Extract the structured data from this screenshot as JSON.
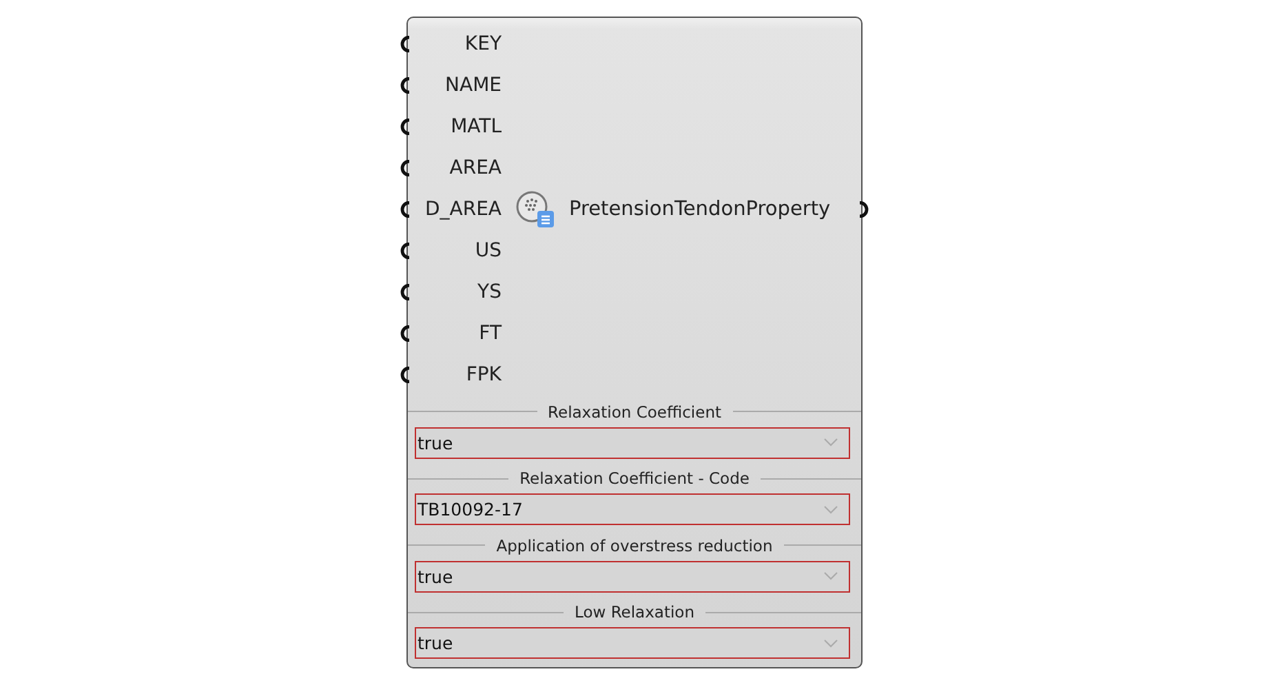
{
  "component": {
    "title": "PretensionTendonProperty",
    "inputs": [
      "KEY",
      "NAME",
      "MATL",
      "AREA",
      "D_AREA",
      "US",
      "YS",
      "FT",
      "FPK"
    ],
    "dropdowns": [
      {
        "label": "Relaxation Coefficient",
        "value": "true"
      },
      {
        "label": "Relaxation Coefficient - Code",
        "value": "TB10092-17"
      },
      {
        "label": "Application of overstress reduction",
        "value": "true"
      },
      {
        "label": "Low Relaxation",
        "value": "true"
      }
    ]
  }
}
